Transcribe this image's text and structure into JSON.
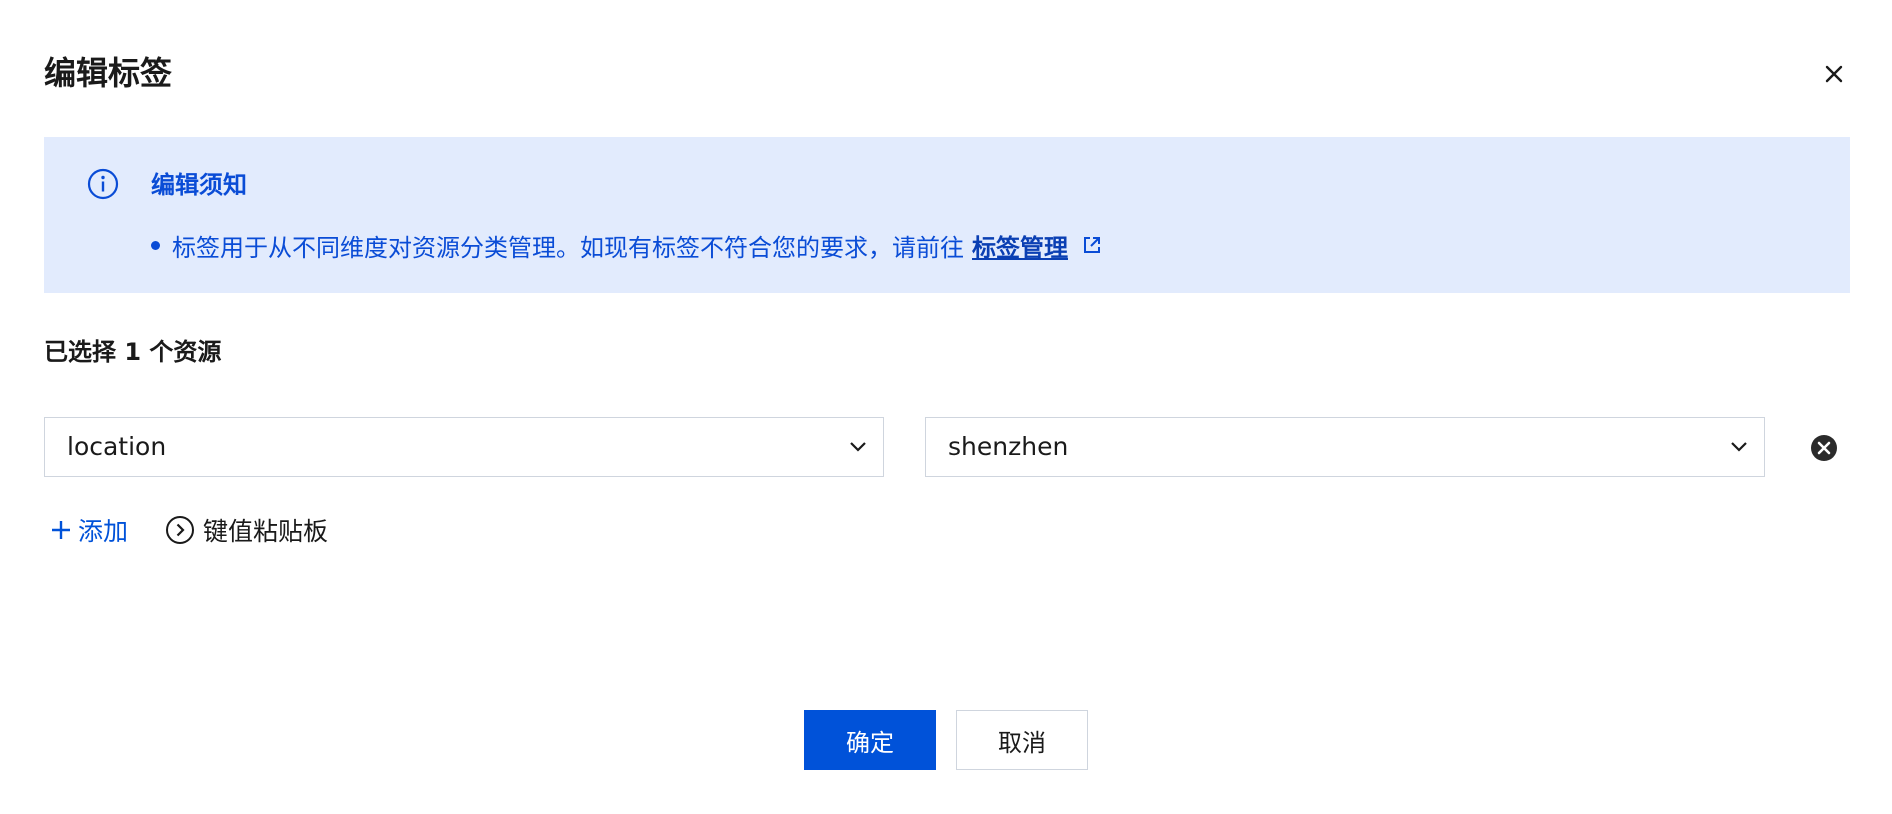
{
  "dialog": {
    "title": "编辑标签",
    "close_icon": "close-icon"
  },
  "notice": {
    "icon": "info-circle-icon",
    "title": "编辑须知",
    "items": [
      {
        "text": "标签用于从不同维度对资源分类管理。如现有标签不符合您的要求，请前往",
        "link_label": "标签管理",
        "link_icon": "external-link-icon"
      }
    ]
  },
  "selection": {
    "label": "已选择 1 个资源"
  },
  "tag_rows": [
    {
      "key": "location",
      "value": "shenzhen",
      "remove_icon": "close-circle-icon"
    }
  ],
  "actions": {
    "add_label": "添加",
    "add_icon": "plus-icon",
    "clipboard_label": "键值粘贴板",
    "clipboard_icon": "chevron-right-circle-icon"
  },
  "footer": {
    "confirm_label": "确定",
    "cancel_label": "取消"
  },
  "colors": {
    "primary": "#0052d9",
    "notice_bg": "#e2ebfd",
    "notice_text": "#0a4cd6",
    "border": "#cfd5de"
  }
}
